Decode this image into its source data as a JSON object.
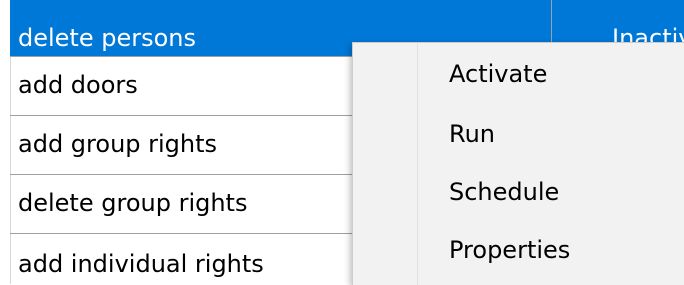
{
  "list": {
    "rows": [
      {
        "name": "delete persons",
        "status": "Inactiv",
        "selected": true
      },
      {
        "name": "add doors",
        "status": ""
      },
      {
        "name": "add group rights",
        "status": ""
      },
      {
        "name": "delete group rights",
        "status": ""
      },
      {
        "name": "add individual rights",
        "status": ""
      }
    ]
  },
  "context_menu": {
    "items": [
      {
        "label": "Activate"
      },
      {
        "label": "Run"
      },
      {
        "label": "Schedule"
      },
      {
        "label": "Properties"
      }
    ]
  },
  "colors": {
    "selection": "#0078d7",
    "grid_line": "#a0a0a0",
    "menu_background": "#f2f2f2"
  }
}
